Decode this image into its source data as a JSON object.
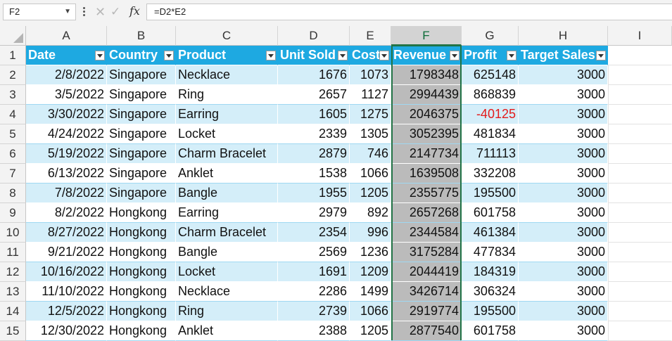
{
  "formula_bar": {
    "name_box": "F2",
    "formula": "=D2*E2"
  },
  "columns": [
    "A",
    "B",
    "C",
    "D",
    "E",
    "F",
    "G",
    "H",
    "I"
  ],
  "table": {
    "headers": [
      "Date",
      "Country",
      "Product",
      "Unit Sold",
      "Cost",
      "Revenue",
      "Profit",
      "Target Sales"
    ],
    "rows": [
      [
        "2/8/2022",
        "Singapore",
        "Necklace",
        "1676",
        "1073",
        "1798348",
        "625148",
        "3000"
      ],
      [
        "3/5/2022",
        "Singapore",
        "Ring",
        "2657",
        "1127",
        "2994439",
        "868839",
        "3000"
      ],
      [
        "3/30/2022",
        "Singapore",
        "Earring",
        "1605",
        "1275",
        "2046375",
        "-40125",
        "3000"
      ],
      [
        "4/24/2022",
        "Singapore",
        "Locket",
        "2339",
        "1305",
        "3052395",
        "481834",
        "3000"
      ],
      [
        "5/19/2022",
        "Singapore",
        "Charm Bracelet",
        "2879",
        "746",
        "2147734",
        "711113",
        "3000"
      ],
      [
        "6/13/2022",
        "Singapore",
        "Anklet",
        "1538",
        "1066",
        "1639508",
        "332208",
        "3000"
      ],
      [
        "7/8/2022",
        "Singapore",
        "Bangle",
        "1955",
        "1205",
        "2355775",
        "195500",
        "3000"
      ],
      [
        "8/2/2022",
        "Hongkong",
        "Earring",
        "2979",
        "892",
        "2657268",
        "601758",
        "3000"
      ],
      [
        "8/27/2022",
        "Hongkong",
        "Charm Bracelet",
        "2354",
        "996",
        "2344584",
        "461384",
        "3000"
      ],
      [
        "9/21/2022",
        "Hongkong",
        "Bangle",
        "2569",
        "1236",
        "3175284",
        "477834",
        "3000"
      ],
      [
        "10/16/2022",
        "Hongkong",
        "Locket",
        "1691",
        "1209",
        "2044419",
        "184319",
        "3000"
      ],
      [
        "11/10/2022",
        "Hongkong",
        "Necklace",
        "2286",
        "1499",
        "3426714",
        "306324",
        "3000"
      ],
      [
        "12/5/2022",
        "Hongkong",
        "Ring",
        "2739",
        "1066",
        "2919774",
        "195500",
        "3000"
      ],
      [
        "12/30/2022",
        "Hongkong",
        "Anklet",
        "2388",
        "1205",
        "2877540",
        "601758",
        "3000"
      ]
    ],
    "row_numbers": [
      "1",
      "2",
      "3",
      "4",
      "5",
      "6",
      "7",
      "8",
      "9",
      "10",
      "11",
      "12",
      "13",
      "14",
      "15"
    ]
  },
  "colors": {
    "header_fill": "#1ea9e1",
    "band_fill": "#d4eef9",
    "selection": "#217346",
    "negative": "#e31b1b"
  }
}
